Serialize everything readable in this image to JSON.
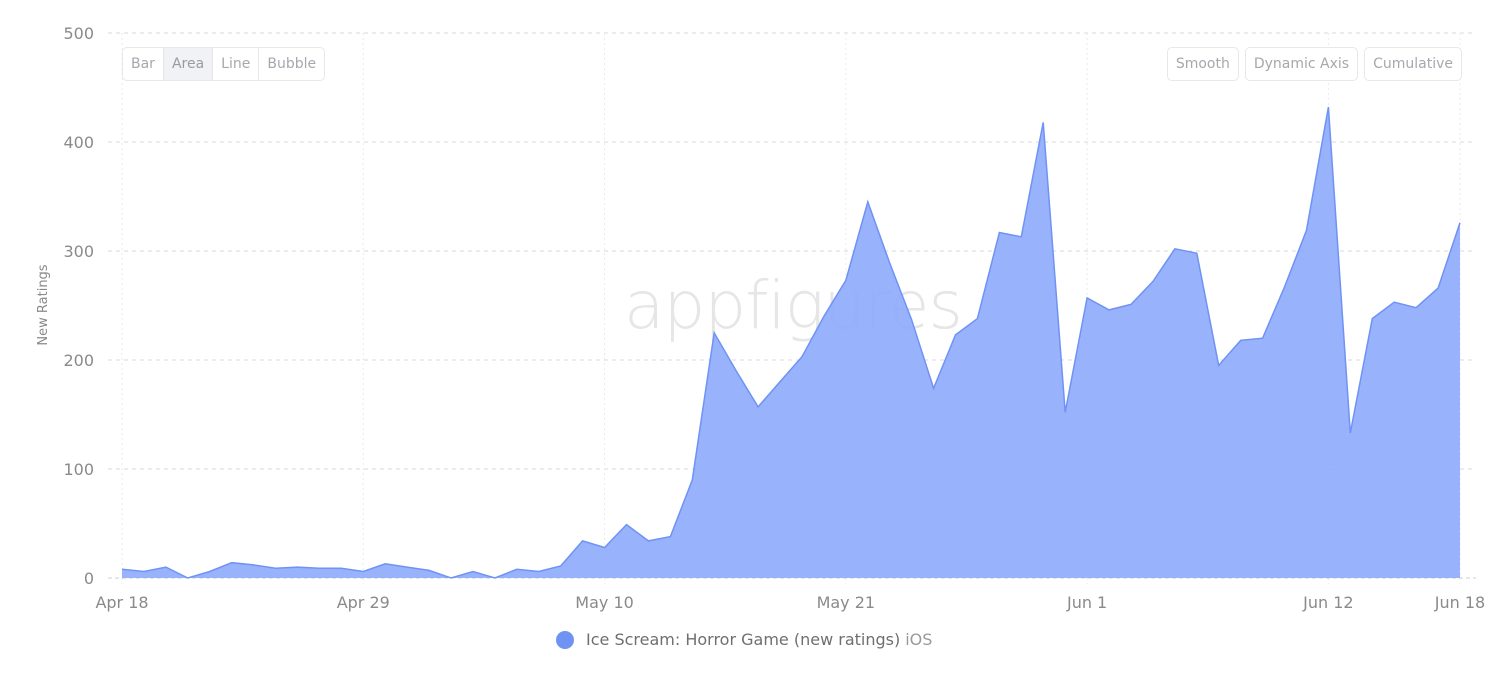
{
  "controls": {
    "chart_types": [
      {
        "label": "Bar",
        "active": false
      },
      {
        "label": "Area",
        "active": true
      },
      {
        "label": "Line",
        "active": false
      },
      {
        "label": "Bubble",
        "active": false
      }
    ],
    "toggles": [
      {
        "label": "Smooth"
      },
      {
        "label": "Dynamic Axis"
      },
      {
        "label": "Cumulative"
      }
    ]
  },
  "watermark": "appfigures",
  "legend": {
    "series_name": "Ice Scream: Horror Game (new ratings)",
    "platform": "iOS",
    "color": "#6f92f5"
  },
  "colors": {
    "area_fill": "#8fabfb",
    "area_line": "#6f92f5",
    "grid": "#d9d9d9",
    "axis_text": "#8a8a8a"
  },
  "chart_data": {
    "type": "area",
    "title": "",
    "xlabel": "",
    "ylabel": "New Ratings",
    "ylim": [
      0,
      500
    ],
    "yticks": [
      0,
      100,
      200,
      300,
      400,
      500
    ],
    "x_start": "Apr 18",
    "x_end": "Jun 18",
    "xtick_labels": [
      {
        "label": "Apr 18",
        "index": 0
      },
      {
        "label": "Apr 29",
        "index": 11
      },
      {
        "label": "May 10",
        "index": 22
      },
      {
        "label": "May 21",
        "index": 33
      },
      {
        "label": "Jun 1",
        "index": 44
      },
      {
        "label": "Jun 12",
        "index": 55
      },
      {
        "label": "Jun 18",
        "index": 61
      }
    ],
    "grid": true,
    "legend_position": "bottom-center",
    "series": [
      {
        "name": "Ice Scream: Horror Game (new ratings) iOS",
        "values": [
          8,
          6,
          10,
          0,
          6,
          14,
          12,
          9,
          10,
          9,
          9,
          6,
          13,
          10,
          7,
          0,
          6,
          0,
          8,
          6,
          11,
          34,
          28,
          49,
          34,
          38,
          90,
          225,
          190,
          157,
          180,
          203,
          240,
          273,
          345,
          289,
          237,
          174,
          223,
          238,
          317,
          313,
          418,
          152,
          257,
          246,
          251,
          272,
          302,
          298,
          195,
          218,
          220,
          267,
          319,
          432,
          133,
          238,
          253,
          248,
          266,
          326
        ]
      }
    ]
  }
}
